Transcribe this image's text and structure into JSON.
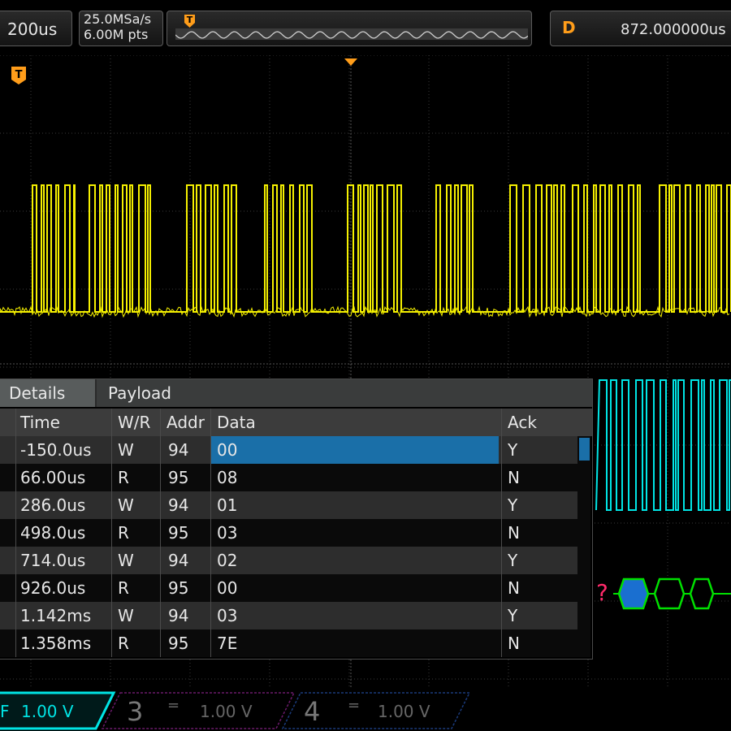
{
  "top_bar": {
    "timebase": "200us",
    "sample_rate": "25.0MSa/s",
    "memory_depth": "6.00M pts",
    "trigger_marker": "T",
    "delay_label": "D",
    "delay_value": "872.000000us"
  },
  "waveform": {
    "trigger_marker": "T",
    "channel1_color": "#f5f000",
    "channel2_color": "#00e5e5",
    "decode_bus_color": "#00e000",
    "decode_error_glyph": "?"
  },
  "decode_table": {
    "tabs": [
      "Details",
      "Payload"
    ],
    "columns": [
      "Time",
      "W/R",
      "Addr",
      "Data",
      "Ack"
    ],
    "rows": [
      {
        "time": "-150.0us",
        "wr": "W",
        "addr": "94",
        "data": "00",
        "ack": "Y"
      },
      {
        "time": "66.00us",
        "wr": "R",
        "addr": "95",
        "data": "08",
        "ack": "N"
      },
      {
        "time": "286.0us",
        "wr": "W",
        "addr": "94",
        "data": "01",
        "ack": "Y"
      },
      {
        "time": "498.0us",
        "wr": "R",
        "addr": "95",
        "data": "03",
        "ack": "N"
      },
      {
        "time": "714.0us",
        "wr": "W",
        "addr": "94",
        "data": "02",
        "ack": "Y"
      },
      {
        "time": "926.0us",
        "wr": "R",
        "addr": "95",
        "data": "00",
        "ack": "N"
      },
      {
        "time": "1.142ms",
        "wr": "W",
        "addr": "94",
        "data": "03",
        "ack": "Y"
      },
      {
        "time": "1.358ms",
        "wr": "R",
        "addr": "95",
        "data": "7E",
        "ack": "N"
      }
    ],
    "selected_row": 0,
    "selection_color": "#1a6fa8"
  },
  "channel_bar": {
    "ch2": {
      "coupling_glyph": "F",
      "scale": "1.00 V",
      "color": "#00e5e5"
    },
    "ch3": {
      "number": "3",
      "coupling_glyph": "=",
      "scale": "1.00 V",
      "color": "#c020c0"
    },
    "ch4": {
      "number": "4",
      "coupling_glyph": "=",
      "scale": "1.00 V",
      "color": "#2060e0"
    }
  }
}
